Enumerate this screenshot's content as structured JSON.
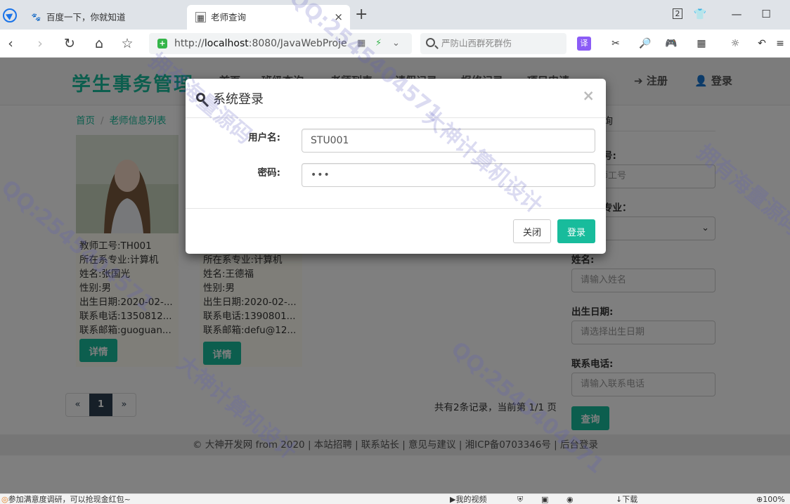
{
  "browser": {
    "tabs": [
      {
        "title": "百度一下，你就知道",
        "active": false
      },
      {
        "title": "老师查询",
        "active": true
      }
    ],
    "new_tab_label": "+",
    "tab_close_label": "×",
    "url_prefix": "http://",
    "url_host": "localhost",
    "url_rest": ":8080/JavaWebProjec",
    "search_placeholder": "严防山西群死群伤",
    "profile_badge": "2",
    "window_controls": {
      "minimize": "—",
      "maximize": "☐",
      "close": "✕"
    }
  },
  "site": {
    "brand": "学生事务管理",
    "nav": [
      "首页",
      "班级查询",
      "老师列表",
      "请假记录",
      "报修记录",
      "项目申请"
    ],
    "register": "注册",
    "login": "登录"
  },
  "breadcrumb": {
    "home": "首页",
    "current": "老师信息列表"
  },
  "teachers": [
    {
      "id": "教师工号:TH001",
      "major": "所在系专业:计算机",
      "name": "姓名:张国光",
      "gender": "性别:男",
      "birth": "出生日期:2020-02-...",
      "phone": "联系电话:1350812...",
      "email": "联系邮箱:guoguan...",
      "detail": "详情"
    },
    {
      "id": "",
      "major": "所在系专业:计算机",
      "name": "姓名:王德福",
      "gender": "性别:男",
      "birth": "出生日期:2020-02-...",
      "phone": "联系电话:1390801...",
      "email": "联系邮箱:defu@12...",
      "detail": "详情"
    }
  ],
  "pager": {
    "prev": "«",
    "current": "1",
    "next": "»",
    "info": "共有2条记录，当前第 1/1 页"
  },
  "sidebar": {
    "title_fragment": "询",
    "fields": [
      {
        "label": "号:",
        "placeholder": "入教师工号"
      },
      {
        "label": "专业：",
        "placeholder": "制"
      },
      {
        "label": "姓名:",
        "placeholder": "请输入姓名"
      },
      {
        "label": "出生日期:",
        "placeholder": "请选择出生日期"
      },
      {
        "label": "联系电话:",
        "placeholder": "请输入联系电话"
      }
    ],
    "query_button": "查询"
  },
  "footer": {
    "text": "© 大神开发网 from 2020 | 本站招聘 | 联系站长 | 意见与建议 | 湘ICP备0703346号 | 后台登录"
  },
  "modal": {
    "title": "系统登录",
    "close_x": "×",
    "username_label": "用户名:",
    "username_value": "STU001",
    "password_label": "密码:",
    "password_value": "•••",
    "close_button": "关闭",
    "login_button": "登录"
  },
  "watermark": [
    "大神计算机设计",
    "QQ:2545404571",
    "拥有海量源码"
  ],
  "statusbar": {
    "left": "参加满意度调研，可以抢现金红包~",
    "video": "我的视频",
    "download": "下载",
    "zoom": "100%"
  }
}
